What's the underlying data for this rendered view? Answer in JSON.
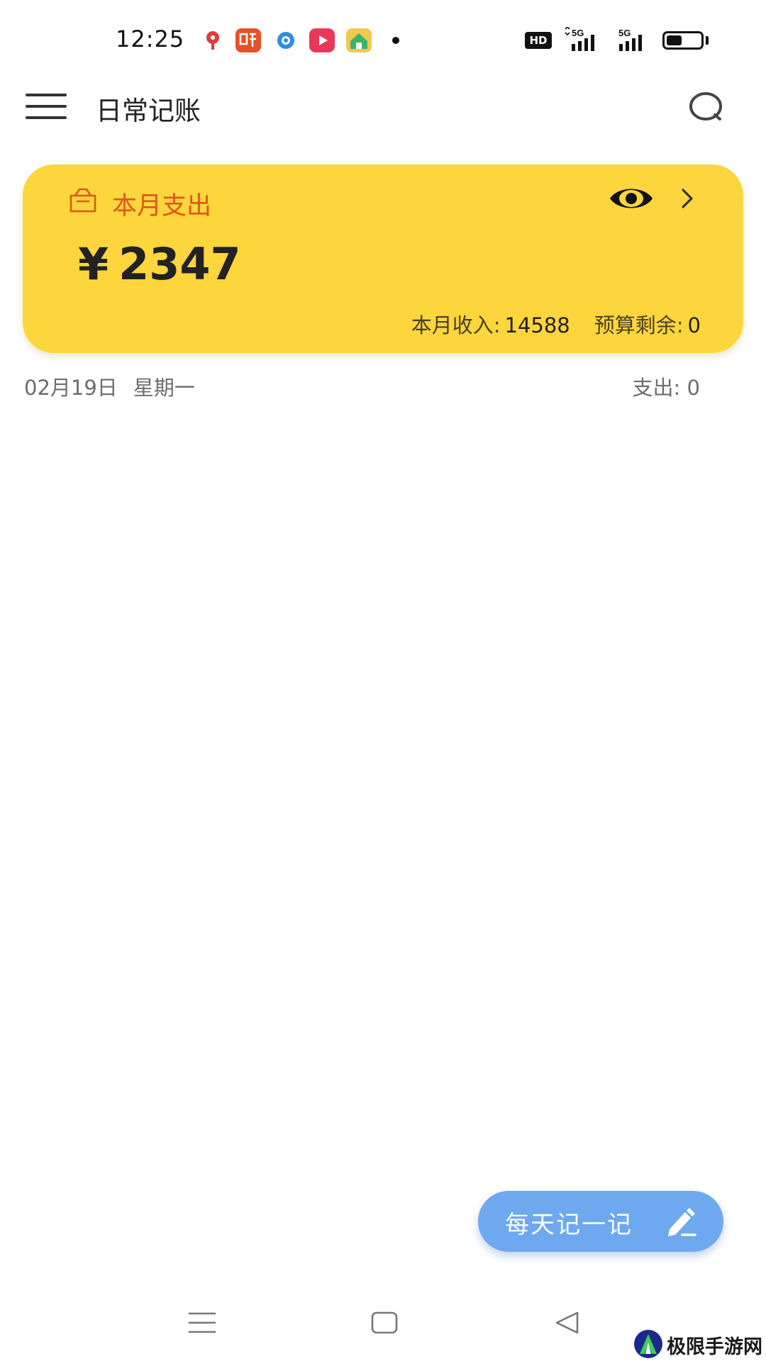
{
  "status_bar": {
    "time": "12:25",
    "network_badge": "HD",
    "signal_label": "5G",
    "battery_level_percent": 45,
    "notification_icons": [
      "map-pin-icon",
      "listen-app-icon",
      "eye-app-icon",
      "video-play-icon",
      "home-app-icon"
    ]
  },
  "header": {
    "title": "日常记账"
  },
  "summary": {
    "label": "本月支出",
    "currency": "¥",
    "amount": "2347",
    "income_label": "本月收入:",
    "income_value": "14588",
    "budget_label": "预算剩余:",
    "budget_value": "0"
  },
  "day": {
    "date": "02月19日",
    "weekday": "星期一",
    "expense_label": "支出:",
    "expense_value": "0"
  },
  "fab": {
    "label": "每天记一记"
  },
  "watermark": {
    "text": "极限手游网"
  },
  "colors": {
    "card_background": "#fdd63e",
    "card_label": "#e0561a",
    "fab_background": "#6ea8ef"
  }
}
